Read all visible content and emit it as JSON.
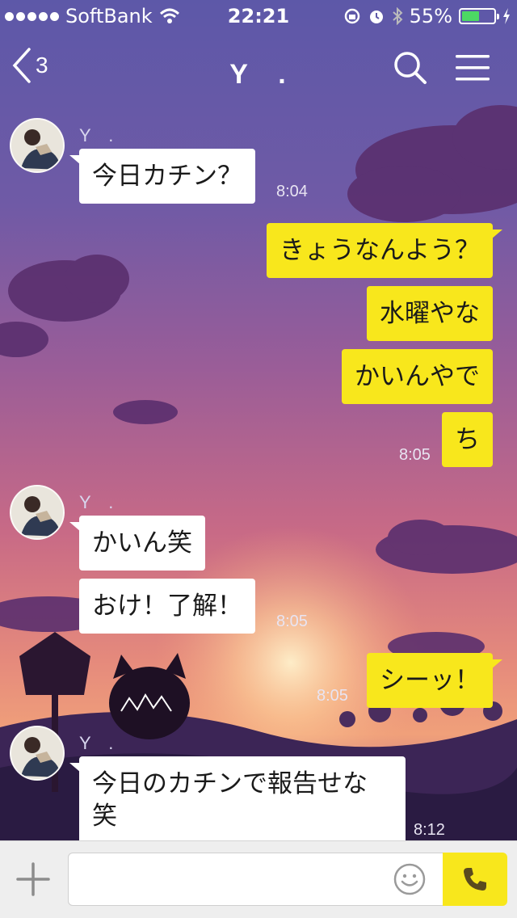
{
  "status_bar": {
    "carrier": "SoftBank",
    "time": "22:21",
    "battery_percent": "55%",
    "battery_level": 0.55,
    "icons": [
      "signal-dots",
      "wifi-icon",
      "rotation-lock-icon",
      "alarm-icon",
      "bluetooth-icon",
      "battery-icon",
      "charging-icon"
    ]
  },
  "nav": {
    "back_count": "3",
    "title": "Y　.",
    "icons": [
      "chevron-left-icon",
      "search-icon",
      "menu-icon"
    ]
  },
  "chat": {
    "sender_name": "Y　.",
    "messages": [
      {
        "side": "in",
        "text": "今日カチン？",
        "time": "8:04"
      },
      {
        "side": "out",
        "text": "きょうなんよう？"
      },
      {
        "side": "out",
        "text": "水曜やな"
      },
      {
        "side": "out",
        "text": "かいんやで"
      },
      {
        "side": "out",
        "text": "ち",
        "time": "8:05"
      },
      {
        "side": "in",
        "text": "かいん笑"
      },
      {
        "side": "in",
        "text": "おけ！了解！",
        "time": "8:05"
      },
      {
        "side": "out",
        "text": "シーッ！",
        "time": "8:05"
      },
      {
        "side": "in",
        "text": "今日のカチンで報告せな笑",
        "line1": "今日のカチンで報告せな",
        "line2": "笑",
        "time": "8:12"
      }
    ]
  },
  "input_bar": {
    "icons": [
      "plus-icon",
      "emoji-icon",
      "phone-icon"
    ],
    "placeholder": ""
  },
  "colors": {
    "accent_yellow": "#f8e71c",
    "incoming_bubble": "#ffffff",
    "nav_text": "#ffffff"
  }
}
